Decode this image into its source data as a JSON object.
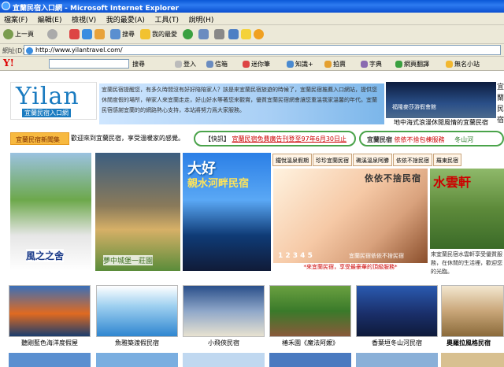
{
  "window": {
    "title": "宜蘭民宿入口網 - Microsoft Internet Explorer"
  },
  "menu": [
    "檔案(F)",
    "編輯(E)",
    "檢視(V)",
    "我的最愛(A)",
    "工具(T)",
    "說明(H)"
  ],
  "toolbar": {
    "back": "上一頁",
    "search": "搜尋",
    "favorites": "我的最愛"
  },
  "address": {
    "label": "網址(D)",
    "url": "http://www.yilantravel.com/"
  },
  "yahoo_bar": {
    "logo": "Y!",
    "search_button": "搜尋",
    "items": [
      "登入",
      "信箱",
      "迷你筆",
      "知識+",
      "拍賣",
      "字典",
      "網頁翻譯",
      "無名小站"
    ]
  },
  "site": {
    "logo_word": "Yilan",
    "logo_sub": "宜蘭民宿入口網",
    "intro": "宜蘭民宿提醒您，有多久時間沒有好好陪陪家人？該是來宜蘭民宿旅遊的時候了，宜蘭民宿推薦入口網站，提供您休閒度假的場所，帶家人來宜蘭走走，好山好水等著您來觀賞，優質宜蘭民宿網會讓您重溫我家溫馨的年代。宜蘭民宿感謝宜蘭的的網路熱心支持，本站將努力爲大家服務。",
    "featured_caption_overlay": "福隆麥莎游假會館",
    "featured_caption": "地中海式浪漫休閒風情的宜蘭民宿",
    "side_text": "宜蘭民宿",
    "news_label": "宜蘭民宿新聞集",
    "news_text": "歡迎來到宜蘭民宿，享受溫暖家的感覺。",
    "flash_label": "【快訊】",
    "flash_link": "宜蘭民宿免費廣告刊登至97年6月30日止",
    "flash2_bold": "宜蘭民宿",
    "flash2_text": "依依不捨包棟服務",
    "flash2_extra": "冬山河",
    "tabs": [
      "鐵悅溫泉假期",
      "珍珍宜蘭民宿",
      "礁溪溫泉阿勝",
      "依依不捨民宿",
      "羅東民宿"
    ],
    "banner1_text": "風之之舍",
    "banner2_text": "夢中城堡一莊園",
    "banner3_title": "大好",
    "banner3_sub": "親水河畔民宿",
    "banner4_title": "依依不捨民宿",
    "banner4_nums": "1 2 3 4 5",
    "banner4_inner_cap": "宜蘭民宿依依不捨民宿",
    "banner4_caption": "*來宜蘭民宿，享受最豪華的頂級服務*",
    "banner5_title": "水雲軒",
    "banner5_text": "來宜蘭民宿水雲軒享受優質服務，在休閒的生活裡，歡迎您的光臨。",
    "thumbs": [
      {
        "caption": "聽剛藍色海洋度假屋"
      },
      {
        "caption": "魚雅築渡假民宿"
      },
      {
        "caption": "小飛俠民宿"
      },
      {
        "caption": "椿禾園《魔法阿嬤》"
      },
      {
        "caption": "香葉垣冬山河民宿"
      },
      {
        "caption": "奧羅拉風格民宿"
      }
    ]
  },
  "colors": {
    "ie_blue": "#0a57d6",
    "chrome": "#ece9d8",
    "accent_green": "#4aa34a",
    "orange": "#f7b940",
    "link_red": "#c00000"
  }
}
